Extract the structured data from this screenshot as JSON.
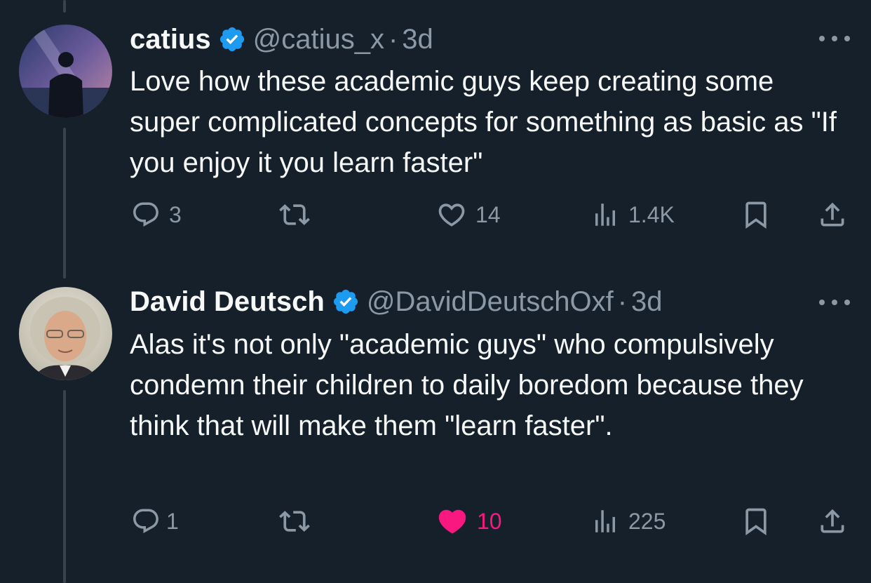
{
  "tweets": [
    {
      "name": "catius",
      "handle": "@catius_x",
      "time": "3d",
      "text": "Love how these academic guys keep creating some super complicated concepts for something as basic as \"If you enjoy it you learn faster\"",
      "replies": "3",
      "reposts": "",
      "likes": "14",
      "views": "1.4K",
      "liked": false
    },
    {
      "name": "David Deutsch",
      "handle": "@DavidDeutschOxf",
      "time": "3d",
      "text": "Alas it's not only \"academic guys\" who compulsively condemn their children to daily boredom because they think that will make them \"learn faster\".",
      "replies": "1",
      "reposts": "",
      "likes": "10",
      "views": "225",
      "liked": true
    }
  ],
  "separator": "·",
  "colors": {
    "background": "#15202b",
    "secondary_text": "#8b98a5",
    "verified": "#1d9bf0",
    "like_active": "#f91880",
    "thread_line": "#38444d"
  },
  "icons": [
    "verified-badge-icon",
    "more-icon",
    "reply-icon",
    "repost-icon",
    "like-icon",
    "views-icon",
    "bookmark-icon",
    "share-icon"
  ]
}
